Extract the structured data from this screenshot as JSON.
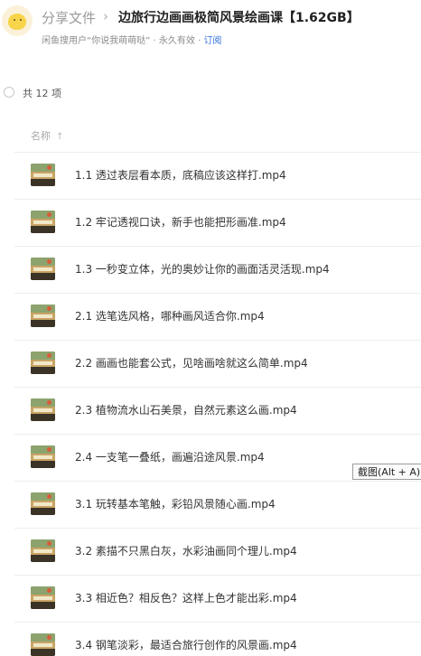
{
  "header": {
    "breadcrumb_root": "分享文件",
    "breadcrumb_sep": "›",
    "title": "边旅行边画画极简风景绘画课【1.62GB】",
    "meta_prefix": "闲鱼搜用户“你说我萌萌哒” · 永久有效 · ",
    "meta_link": "订阅"
  },
  "summary": {
    "count": "共 12 项"
  },
  "column": {
    "name_label": "名称",
    "sort_icon": "↑"
  },
  "files": [
    {
      "name": "1.1 透过表层看本质，底稿应该这样打.mp4",
      "icon": "video-thumbnail-icon"
    },
    {
      "name": "1.2 牢记透视口诀，新手也能把形画准.mp4",
      "icon": "video-thumbnail-icon"
    },
    {
      "name": "1.3 一秒变立体，光的奥妙让你的画面活灵活现.mp4",
      "icon": "video-thumbnail-icon"
    },
    {
      "name": "2.1 选笔选风格，哪种画风适合你.mp4",
      "icon": "video-thumbnail-icon"
    },
    {
      "name": "2.2 画画也能套公式，见啥画啥就这么简单.mp4",
      "icon": "video-thumbnail-icon"
    },
    {
      "name": "2.3 植物流水山石美景，自然元素这么画.mp4",
      "icon": "video-thumbnail-icon"
    },
    {
      "name": "2.4 一支笔一叠纸，画遍沿途风景.mp4",
      "icon": "video-thumbnail-icon"
    },
    {
      "name": "3.1 玩转基本笔触，彩铅风景随心画.mp4",
      "icon": "video-thumbnail-icon"
    },
    {
      "name": "3.2 素描不只黑白灰，水彩油画同个理儿.mp4",
      "icon": "video-thumbnail-icon"
    },
    {
      "name": "3.3 相近色？相反色？这样上色才能出彩.mp4",
      "icon": "video-thumbnail-icon"
    },
    {
      "name": "3.4 钢笔淡彩，最适合旅行创作的风景画.mp4",
      "icon": "video-thumbnail-icon"
    }
  ],
  "tooltip": {
    "text": "截图(Alt + A)"
  },
  "colors": {
    "link": "#2f6fd6",
    "title": "#1f1f1f",
    "muted": "#9a9a9a"
  }
}
